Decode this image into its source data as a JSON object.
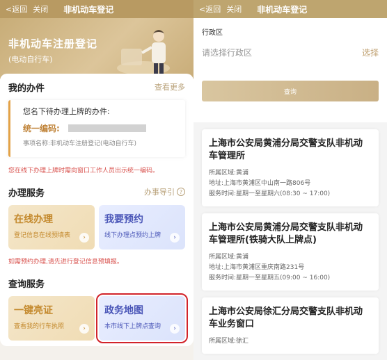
{
  "left": {
    "topbar": {
      "back": "<返回",
      "close": "关闭",
      "title": "非机动车登记"
    },
    "hero": {
      "title": "非机动车注册登记",
      "subtitle": "(电动自行车)"
    },
    "my_tasks": {
      "title": "我的办件",
      "more": "查看更多"
    },
    "task": {
      "line1": "您名下待办理上牌的办件:",
      "code_label": "统一编码:",
      "item": "事项名称:非机动车注册登记(电动自行车)"
    },
    "task_note": "您在线下办理上牌时需向窗口工作人员出示统一编码。",
    "services": {
      "title": "办理服务",
      "guide": "办事导引"
    },
    "tile_online": {
      "title": "在线办理",
      "sub": "登记信息在线预填表"
    },
    "tile_appoint": {
      "title": "我要预约",
      "sub": "线下办理点预约上牌"
    },
    "service_note": "如需预约办理,请先进行登记信息预填报。",
    "query": {
      "title": "查询服务"
    },
    "tile_check": {
      "title": "一键亮证",
      "sub": "查看我的行车执照"
    },
    "tile_map": {
      "title": "政务地图",
      "sub": "本市线下上牌点查询"
    }
  },
  "right": {
    "topbar": {
      "back": "<返回",
      "close": "关闭",
      "title": "非机动车登记"
    },
    "form": {
      "label": "行政区",
      "placeholder": "请选择行政区",
      "select": "选择",
      "button": "查询"
    },
    "sites": [
      {
        "name": "上海市公安局黄浦分局交警支队非机动车管理所",
        "area": "所属区域:黄浦",
        "addr": "地址:上海市黄浦区中山南一路806号",
        "hours": "服务时间:星期一至星期六(08:30 ~ 17:00)"
      },
      {
        "name": "上海市公安局黄浦分局交警支队非机动车管理所(铁骑大队上牌点)",
        "area": "所属区域:黄浦",
        "addr": "地址:上海市黄浦区重庆南路231号",
        "hours": "服务时间:星期一至星期五(09:00 ~ 16:00)"
      },
      {
        "name": "上海市公安局徐汇分局交警支队非机动车业务窗口",
        "area": "所属区域:徐汇"
      }
    ]
  },
  "colors": {
    "gold": "#b89a62",
    "accent_red": "#d2232a",
    "blue": "#4b57b8"
  },
  "icons": {
    "back": "chevron-left-icon",
    "help": "question-circle-icon",
    "arrow": "chevron-right-icon"
  }
}
